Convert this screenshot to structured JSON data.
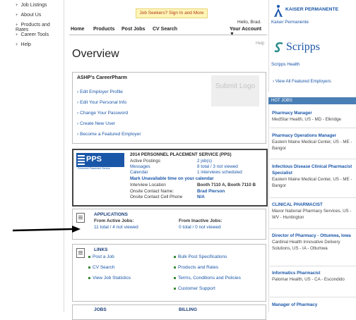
{
  "sidebar": {
    "items": [
      {
        "label": "Job Listings"
      },
      {
        "label": "About Us"
      },
      {
        "label": "Products and Rates"
      },
      {
        "label": "Career Tools"
      },
      {
        "label": "Help"
      }
    ]
  },
  "header": {
    "seekers_link": "Job Seekers? Sign In and More",
    "hello": "Hello, Brad.",
    "nav": [
      "Home",
      "Products",
      "Post Jobs",
      "CV Search",
      "Your Account ▼"
    ],
    "help": "Help"
  },
  "page_title": "Overview",
  "careerpharm": {
    "title": "ASHP's CareerPharm",
    "links": [
      "Edit Employer Profile",
      "Edit Your Personal Info",
      "Change Your Password",
      "Create New User",
      "Become a Featured Employer"
    ],
    "submit_logo": "Submit Logo"
  },
  "pps": {
    "logo": "PPS",
    "logo_sub": "Personnel Placement Service",
    "title": "2014 PERSONNEL PLACEMENT SERVICE (PPS)",
    "rows": [
      {
        "label": "Active Postings",
        "value": "2 job(s)"
      },
      {
        "label": "Messages",
        "value": "8 total / 3 not viewed"
      },
      {
        "label": "Calendar",
        "value": "1 interviews scheduled"
      }
    ],
    "unavailable": "Mark Unavailable time on your calendar",
    "rows2": [
      {
        "label": "Interview Location",
        "value": "Booth 7110 A, Booth 7110 B"
      },
      {
        "label": "Onsite Contact Name:",
        "value": "Brad Pierson"
      },
      {
        "label": "Onsite Contact Cell Phone",
        "value": "N/A"
      }
    ]
  },
  "applications": {
    "title": "APPLICATIONS",
    "active_label": "From Active Jobs:",
    "active_value": "11 total / 4 not viewed",
    "inactive_label": "From Inactive Jobs:",
    "inactive_value": "0 total / 0 not viewed"
  },
  "links_box": {
    "title": "LINKS",
    "left": [
      "Post a Job",
      "CV Search",
      "View Job Statistics"
    ],
    "right": [
      "Bulk Post Specifications",
      "Products and Rates",
      "Terms, Conditions and Policies",
      "Customer Support"
    ]
  },
  "bottom": {
    "jobs": "JOBS",
    "billing": "BILLING"
  },
  "featured": {
    "kp_name": "KAISER PERMANENTE",
    "kp_link": "Kaiser Permanente",
    "scripps_name": "Scripps",
    "scripps_link": "Scripps Health",
    "view_all": "View All Featured Employers"
  },
  "hot_jobs": {
    "title": "HOT JOBS",
    "jobs": [
      {
        "title": "Pharmacy Manager",
        "detail": "MedStar Health, US - MD - Elkridge"
      },
      {
        "title": "Pharmacy Operations Manager",
        "detail": "Eastern Maine Medical Center, US - ME - Bangor"
      },
      {
        "title": "Infectious Disease Clinical Pharmacist Specialist",
        "detail": "Eastern Maine Medical Center, US - ME - Bangor"
      },
      {
        "title": "CLINICAL PHARMACIST",
        "detail": "Maxor National Pharmacy Services, US - WV - Huntington"
      },
      {
        "title": "Director of Pharmacy - Ottumwa, Iowa",
        "detail": "Cardinal Health Innovative Delivery Solutions, US - IA - Ottumwa"
      },
      {
        "title": "Informatics Pharmacist",
        "detail": "Palomar Health, US - CA - Escondido"
      },
      {
        "title": "Manager of Pharmacy",
        "detail": ""
      }
    ]
  }
}
